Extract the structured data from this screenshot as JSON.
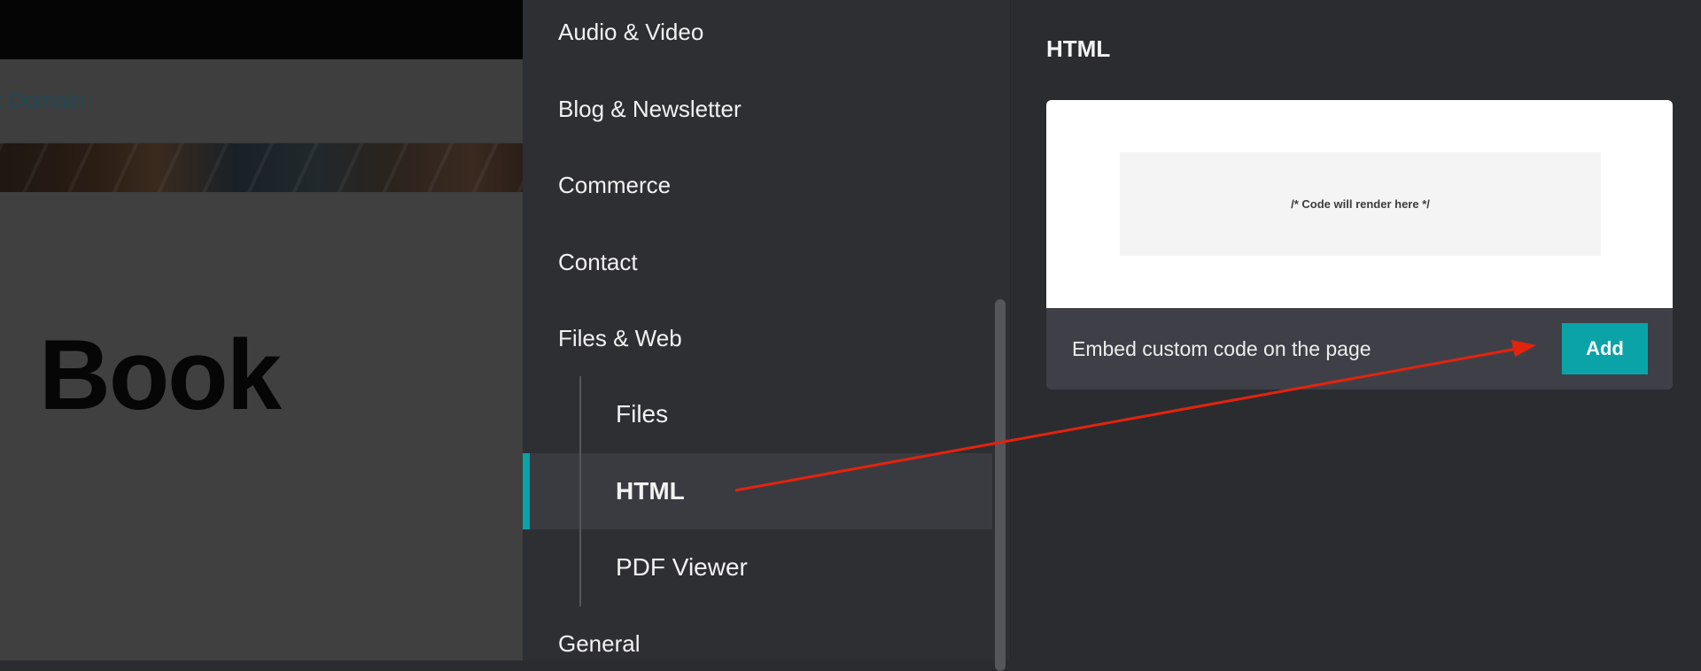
{
  "site_preview": {
    "nav_link": "t Domain",
    "heading": "Book"
  },
  "categories": [
    {
      "label": "Audio & Video"
    },
    {
      "label": "Blog & Newsletter"
    },
    {
      "label": "Commerce"
    },
    {
      "label": "Contact"
    },
    {
      "label": "Files & Web"
    }
  ],
  "subcategories": [
    {
      "label": "Files"
    },
    {
      "label": "HTML",
      "active": true
    },
    {
      "label": "PDF Viewer"
    }
  ],
  "categories_after": [
    {
      "label": "General"
    }
  ],
  "detail": {
    "title": "HTML",
    "preview_text": "/* Code will render here */",
    "description": "Embed custom code on the page",
    "add_label": "Add"
  },
  "colors": {
    "accent": "#09a3a8",
    "annotation_arrow": "#e3230e"
  }
}
